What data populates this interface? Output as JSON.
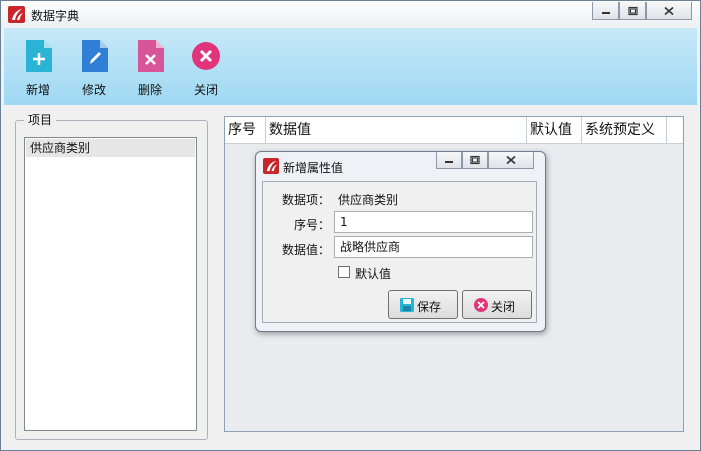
{
  "window": {
    "title": "数据字典",
    "icon": "app-logo-icon",
    "controls": [
      "minimize-icon",
      "restore-icon",
      "close-icon"
    ]
  },
  "toolbar": {
    "items": [
      {
        "label": "新增",
        "icon": "file-add-icon",
        "color": "#2bb3d6"
      },
      {
        "label": "修改",
        "icon": "file-edit-icon",
        "color": "#2f7fd6"
      },
      {
        "label": "删除",
        "icon": "file-delete-icon",
        "color": "#d9559a"
      },
      {
        "label": "关闭",
        "icon": "close-circle-icon",
        "color": "#e0357a"
      }
    ]
  },
  "left_panel": {
    "legend": "项目",
    "items": [
      "供应商类别"
    ]
  },
  "grid": {
    "columns": [
      "序号",
      "数据值",
      "默认值",
      "系统预定义"
    ]
  },
  "dialog": {
    "title": "新增属性值",
    "item_label": "数据项：",
    "item_value": "供应商类别",
    "seq_label": "序号：",
    "seq_value": "1",
    "value_label": "数据值：",
    "value_value": "战略供应商",
    "default_label": "默认值",
    "default_checked": false,
    "save_label": "保存",
    "close_label": "关闭"
  },
  "colors": {
    "toolbar_top": "#c6e9f8",
    "toolbar_bottom": "#9fd8f3",
    "brand_red": "#c8262b"
  }
}
